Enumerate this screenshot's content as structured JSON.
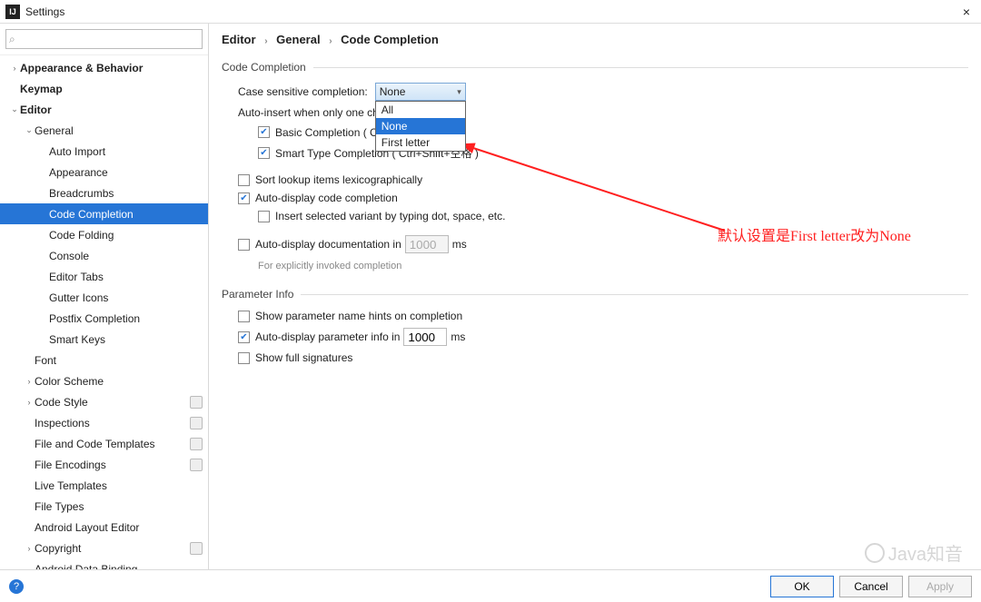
{
  "window": {
    "title": "Settings",
    "logo": "IJ"
  },
  "search": {
    "placeholder": ""
  },
  "tree": [
    {
      "label": "Appearance & Behavior",
      "indent": 0,
      "arrow": "›",
      "bold": true
    },
    {
      "label": "Keymap",
      "indent": 0,
      "arrow": "",
      "bold": true
    },
    {
      "label": "Editor",
      "indent": 0,
      "arrow": "⌄",
      "bold": true
    },
    {
      "label": "General",
      "indent": 1,
      "arrow": "⌄"
    },
    {
      "label": "Auto Import",
      "indent": 2,
      "arrow": ""
    },
    {
      "label": "Appearance",
      "indent": 2,
      "arrow": ""
    },
    {
      "label": "Breadcrumbs",
      "indent": 2,
      "arrow": ""
    },
    {
      "label": "Code Completion",
      "indent": 2,
      "arrow": "",
      "selected": true
    },
    {
      "label": "Code Folding",
      "indent": 2,
      "arrow": ""
    },
    {
      "label": "Console",
      "indent": 2,
      "arrow": ""
    },
    {
      "label": "Editor Tabs",
      "indent": 2,
      "arrow": ""
    },
    {
      "label": "Gutter Icons",
      "indent": 2,
      "arrow": ""
    },
    {
      "label": "Postfix Completion",
      "indent": 2,
      "arrow": ""
    },
    {
      "label": "Smart Keys",
      "indent": 2,
      "arrow": ""
    },
    {
      "label": "Font",
      "indent": 1,
      "arrow": ""
    },
    {
      "label": "Color Scheme",
      "indent": 1,
      "arrow": "›"
    },
    {
      "label": "Code Style",
      "indent": 1,
      "arrow": "›",
      "badge": true
    },
    {
      "label": "Inspections",
      "indent": 1,
      "arrow": "",
      "badge": true
    },
    {
      "label": "File and Code Templates",
      "indent": 1,
      "arrow": "",
      "badge": true
    },
    {
      "label": "File Encodings",
      "indent": 1,
      "arrow": "",
      "badge": true
    },
    {
      "label": "Live Templates",
      "indent": 1,
      "arrow": ""
    },
    {
      "label": "File Types",
      "indent": 1,
      "arrow": ""
    },
    {
      "label": "Android Layout Editor",
      "indent": 1,
      "arrow": ""
    },
    {
      "label": "Copyright",
      "indent": 1,
      "arrow": "›",
      "badge": true
    },
    {
      "label": "Android Data Binding",
      "indent": 1,
      "arrow": ""
    }
  ],
  "breadcrumb": {
    "a": "Editor",
    "b": "General",
    "c": "Code Completion",
    "sep": "›"
  },
  "section1": {
    "title": "Code Completion",
    "case_label": "Case sensitive completion:",
    "case_value": "None",
    "case_options": [
      "All",
      "None",
      "First letter"
    ],
    "auto_insert": "Auto-insert when only one choice on:",
    "basic": "Basic Completion ( Ctrl+空格 )",
    "smart": "Smart Type Completion ( Ctrl+Shift+空格 )",
    "sort": "Sort lookup items lexicographically",
    "autodisplay": "Auto-display code completion",
    "insert_variant": "Insert selected variant by typing dot, space, etc.",
    "autodoc": "Auto-display documentation in",
    "autodoc_ms": "1000",
    "ms": "ms",
    "autodoc_hint": "For explicitly invoked completion"
  },
  "section2": {
    "title": "Parameter Info",
    "hints": "Show parameter name hints on completion",
    "autoparam": "Auto-display parameter info in",
    "autoparam_ms": "1000",
    "ms": "ms",
    "full": "Show full signatures"
  },
  "annotation": "默认设置是First letter改为None",
  "footer": {
    "ok": "OK",
    "cancel": "Cancel",
    "apply": "Apply"
  },
  "watermark": "Java知音"
}
